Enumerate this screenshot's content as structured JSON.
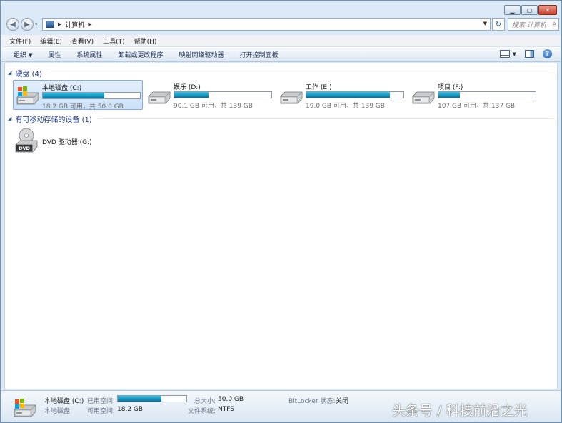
{
  "window": {
    "minimize_icon": "minimize-icon",
    "maximize_icon": "maximize-icon",
    "close_icon": "close-icon"
  },
  "address_bar": {
    "crumb": "计算机",
    "search_placeholder": "搜索 计算机"
  },
  "menu": {
    "items": [
      {
        "label": "文件(F)"
      },
      {
        "label": "编辑(E)"
      },
      {
        "label": "查看(V)"
      },
      {
        "label": "工具(T)"
      },
      {
        "label": "帮助(H)"
      }
    ]
  },
  "command_bar": {
    "items": [
      {
        "label": "组织"
      },
      {
        "label": "属性"
      },
      {
        "label": "系统属性"
      },
      {
        "label": "卸载或更改程序"
      },
      {
        "label": "映射网络驱动器"
      },
      {
        "label": "打开控制面板"
      }
    ]
  },
  "groups": {
    "hard_disks": {
      "label": "硬盘 (4)"
    },
    "removable": {
      "label": "有可移动存储的设备 (1)"
    }
  },
  "drives": [
    {
      "name": "本地磁盘 (C:)",
      "free_text": "18.2 GB 可用，共 50.0 GB",
      "used_fraction": 0.636,
      "selected": true,
      "system": true
    },
    {
      "name": "娱乐 (D:)",
      "free_text": "90.1 GB 可用，共 139 GB",
      "used_fraction": 0.352,
      "selected": false,
      "system": false
    },
    {
      "name": "工作 (E:)",
      "free_text": "19.0 GB 可用，共 139 GB",
      "used_fraction": 0.863,
      "selected": false,
      "system": false
    },
    {
      "name": "项目 (F:)",
      "free_text": "107 GB 可用，共 137 GB",
      "used_fraction": 0.219,
      "selected": false,
      "system": false
    }
  ],
  "removable": [
    {
      "name": "DVD 驱动器 (G:)",
      "disc_label": "DVD"
    }
  ],
  "details": {
    "name": "本地磁盘 (C:)",
    "type": "本地磁盘",
    "used_label": "已用空间:",
    "used_fraction": 0.636,
    "free_label": "可用空间:",
    "free_value": "18.2 GB",
    "total_label": "总大小:",
    "total_value": "50.0 GB",
    "fs_label": "文件系统:",
    "fs_value": "NTFS",
    "bitlocker_label": "BitLocker 状态:",
    "bitlocker_value": "关闭"
  },
  "watermark": "头条号 / 科技前沿之光",
  "colors": {
    "bar_fill": "#1896bf",
    "selection_bg": "#cce1f8",
    "group_header": "#1e3a80"
  }
}
